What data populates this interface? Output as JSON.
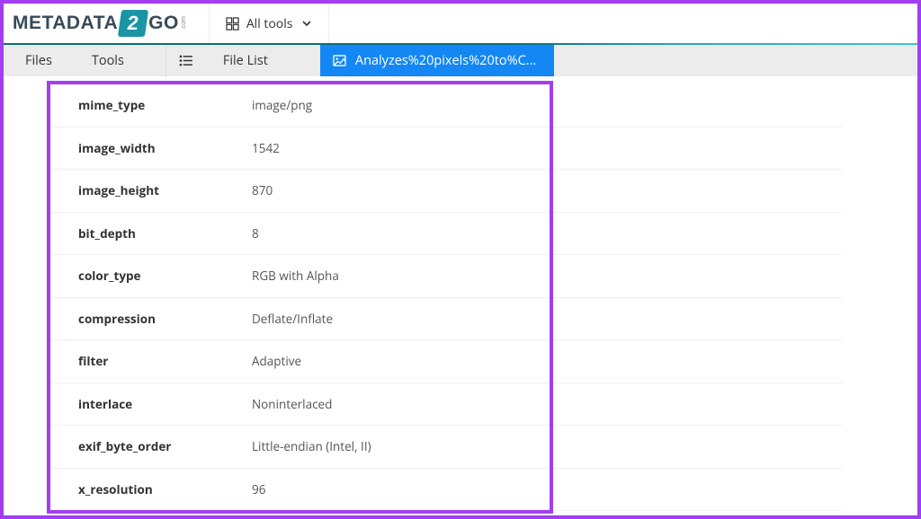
{
  "header": {
    "logo_pre": "METADATA",
    "logo_digit": "2",
    "logo_post": "GO",
    "logo_sup": ".com",
    "all_tools_label": "All tools"
  },
  "tabs": {
    "files": "Files",
    "tools": "Tools",
    "file_list": "File List",
    "active_file": "Analyzes%20pixels%20to%C..."
  },
  "metadata": [
    {
      "key": "mime_type",
      "value": "image/png"
    },
    {
      "key": "image_width",
      "value": "1542"
    },
    {
      "key": "image_height",
      "value": "870"
    },
    {
      "key": "bit_depth",
      "value": "8"
    },
    {
      "key": "color_type",
      "value": "RGB with Alpha"
    },
    {
      "key": "compression",
      "value": "Deflate/Inflate"
    },
    {
      "key": "filter",
      "value": "Adaptive"
    },
    {
      "key": "interlace",
      "value": "Noninterlaced"
    },
    {
      "key": "exif_byte_order",
      "value": "Little-endian (Intel, II)"
    },
    {
      "key": "x_resolution",
      "value": "96"
    }
  ]
}
